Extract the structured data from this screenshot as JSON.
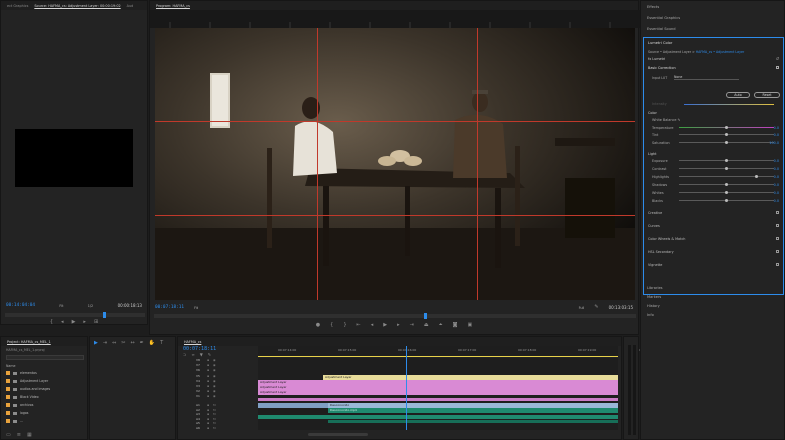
{
  "source_monitor": {
    "tabs": [
      "ect Graphics",
      "Source: HAFMA_cs: Adjustment Layer: 00:00:19:02",
      "Aud"
    ],
    "timecode_left": "00:14:04:04",
    "fit": "Fit",
    "ratio": "1/2",
    "timecode_right": "00:00:18:13"
  },
  "program_monitor": {
    "tab": "Program: HAFMA_cs",
    "timecode_left": "00:07:18:11",
    "fit": "Fit",
    "ratio": "Full",
    "timecode_right": "00:13:03:15"
  },
  "project_panel": {
    "tab": "Project: HAFMA_cs_MEL_1",
    "file": "HAFMA_cs_MEL_1.prproj",
    "column_header": "Name",
    "items": [
      {
        "name": "elementos",
        "color": "#e8a23c"
      },
      {
        "name": "Adjustment Layer",
        "color": "#e8a23c"
      },
      {
        "name": "audios and images",
        "color": "#e8a23c"
      },
      {
        "name": "Black Video",
        "color": "#e8a23c"
      },
      {
        "name": "archivos",
        "color": "#e8a23c"
      },
      {
        "name": "logos",
        "color": "#e8a23c"
      },
      {
        "name": "...",
        "color": "#e8a23c"
      }
    ]
  },
  "timeline": {
    "tab": "HAFMA_cs",
    "timecode": "00:07:18:11",
    "ruler": [
      "00:07:14:00",
      "00:07:15:00",
      "00:07:16:00",
      "00:07:17:00",
      "00:07:18:00",
      "00:07:19:00",
      "00:07:20:00"
    ],
    "video_tracks": [
      "V8",
      "V7",
      "V6",
      "V5",
      "V4",
      "V3",
      "V2",
      "V1"
    ],
    "audio_tracks": [
      "A1",
      "A2",
      "A3",
      "A4",
      "A5",
      "A6"
    ],
    "clips": {
      "yellow": "Adjustment Layer",
      "pink1": "Adjustment Layer",
      "pink2": "Adjustment Layer",
      "pink3": "Adjustment Layer",
      "pink4": "Adjustment Layer",
      "v1": "Desconocido",
      "v1b": "Desconocido.mp4"
    }
  },
  "effects_panel": {
    "headers": [
      "Effects",
      "Essential Graphics",
      "Essential Sound",
      "Lumetri Color"
    ],
    "source": "Source • Adjustment Layer",
    "sequence": "HAFMA_cs • Adjustment Layer",
    "preset": "fx Lumetri",
    "basic_correction": "Basic Correction",
    "input_lut_label": "Input LUT",
    "input_lut_value": "None",
    "auto_button": "Auto",
    "reset_button": "Reset",
    "intensity": "Intensity",
    "color_section": "Color",
    "white_balance": "White Balance",
    "temperature": {
      "label": "Temperature",
      "value": "0.0",
      "level": 0.5
    },
    "tint": {
      "label": "Tint",
      "value": "0.0",
      "level": 0.5
    },
    "saturation": {
      "label": "Saturation",
      "value": "100.0",
      "level": 0.5
    },
    "light_section": "Light",
    "light": [
      {
        "label": "Exposure",
        "value": "0.0",
        "level": 0.5
      },
      {
        "label": "Contrast",
        "value": "0.0",
        "level": 0.5
      },
      {
        "label": "Highlights",
        "value": "0.0",
        "level": 0.82
      },
      {
        "label": "Shadows",
        "value": "0.0",
        "level": 0.5
      },
      {
        "label": "Whites",
        "value": "0.0",
        "level": 0.5
      },
      {
        "label": "Blacks",
        "value": "0.0",
        "level": 0.5
      }
    ],
    "sections": [
      "Creative",
      "Curves",
      "Color Wheels & Match",
      "HSL Secondary",
      "Vignette"
    ],
    "bottom": [
      "Libraries",
      "Markers",
      "History",
      "Info"
    ]
  },
  "colors": {
    "accent": "#2d8ceb",
    "pink_clip": "#d98ad4",
    "yellow_clip": "#e8dc9a",
    "teal_clip": "#1f8a6f",
    "guide_red": "#c0392b"
  }
}
